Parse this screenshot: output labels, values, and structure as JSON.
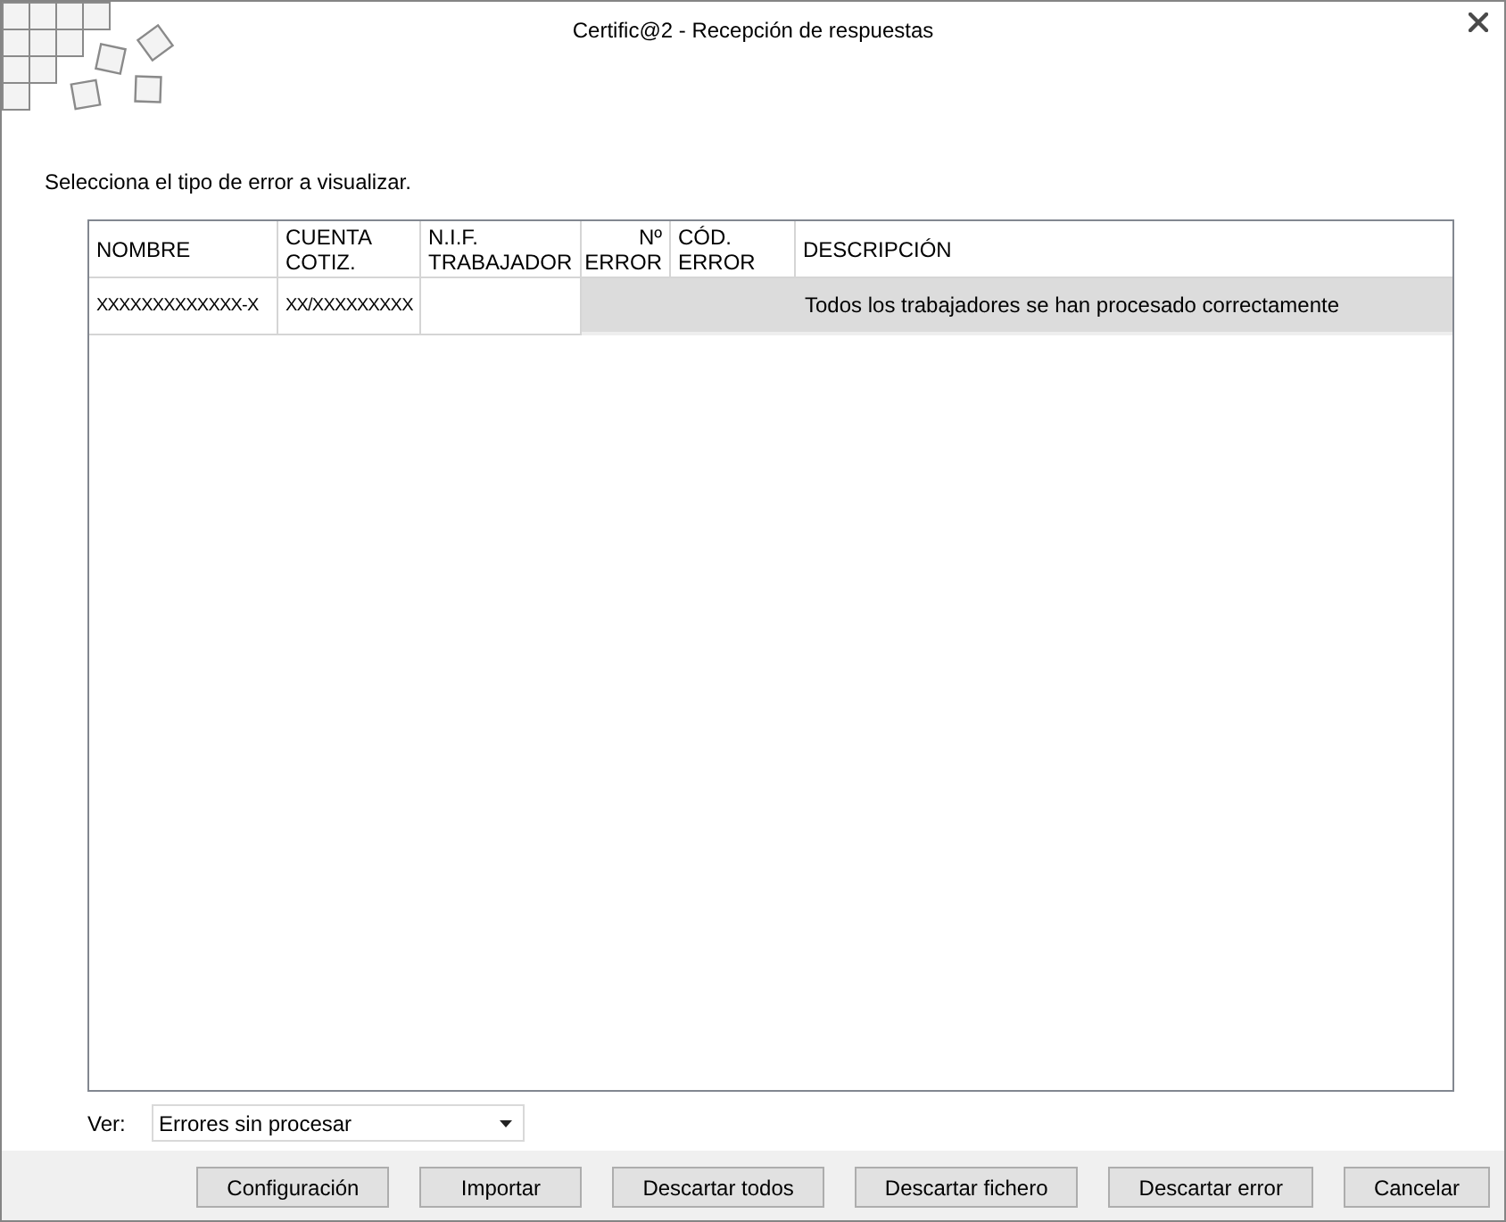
{
  "window": {
    "title": "Certific@2 - Recepción de respuestas"
  },
  "instruction": "Selecciona el tipo de error a visualizar.",
  "table": {
    "columns": [
      {
        "label": "NOMBRE",
        "numeric": false
      },
      {
        "label": "CUENTA\nCOTIZ.",
        "numeric": false
      },
      {
        "label": "N.I.F.\nTRABAJADOR",
        "numeric": false
      },
      {
        "label": "Nº\nERROR",
        "numeric": true
      },
      {
        "label": "CÓD.\nERROR",
        "numeric": false
      },
      {
        "label": "DESCRIPCIÓN",
        "numeric": false
      }
    ],
    "rows": [
      {
        "kind": "message",
        "nombre": "XXXXXXXXXXXXX-X",
        "cuenta_cotiz": "XX/XXXXXXXXX",
        "message": "Todos los trabajadores se han procesado correctamente"
      }
    ]
  },
  "filter": {
    "label": "Ver:",
    "value": "Errores sin procesar"
  },
  "buttons": [
    "Configuración",
    "Importar",
    "Descartar todos",
    "Descartar fichero",
    "Descartar error",
    "Cancelar"
  ]
}
